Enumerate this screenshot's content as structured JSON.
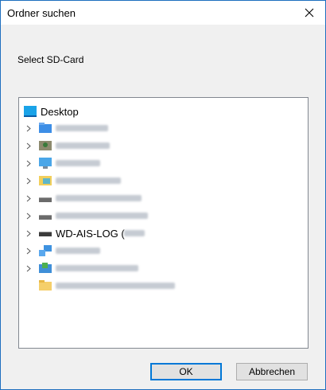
{
  "window": {
    "title": "Ordner suchen"
  },
  "description": "Select SD-Card",
  "tree": {
    "root_label": "Desktop",
    "drive_label_prefix": "WD-AIS-LOG (",
    "items": [
      {
        "icon": "blue-folder-icon",
        "expandable": true
      },
      {
        "icon": "user-folder-icon",
        "expandable": true
      },
      {
        "icon": "computer-icon",
        "expandable": true
      },
      {
        "icon": "libraries-icon",
        "expandable": true
      },
      {
        "icon": "drive-icon",
        "expandable": true
      },
      {
        "icon": "drive-icon",
        "expandable": true
      },
      {
        "icon": "usb-drive-icon",
        "expandable": true
      },
      {
        "icon": "network-icon",
        "expandable": true
      },
      {
        "icon": "control-panel-icon",
        "expandable": true
      },
      {
        "icon": "yellow-folder-icon",
        "expandable": false
      }
    ]
  },
  "buttons": {
    "ok": "OK",
    "cancel": "Abbrechen"
  },
  "colors": {
    "accent": "#0078d7",
    "border": "#1e6fbf"
  }
}
